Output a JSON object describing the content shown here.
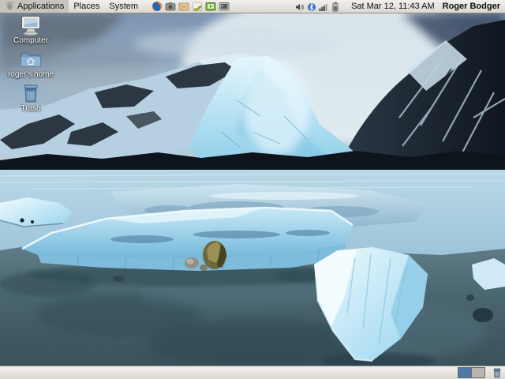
{
  "top_panel": {
    "menus": [
      {
        "label": "Applications"
      },
      {
        "label": "Places"
      },
      {
        "label": "System"
      }
    ],
    "launcher_icons": [
      "firefox-browser",
      "camera",
      "mail",
      "text-editor",
      "media-player",
      "terminal"
    ],
    "status_icons": [
      "volume",
      "bluetooth",
      "network-signal",
      "battery"
    ],
    "clock": "Sat Mar 12, 11:43 AM",
    "user_name": "Roger Bodger"
  },
  "desktop": {
    "icons": [
      {
        "label": "Computer",
        "icon": "computer"
      },
      {
        "label": "roger's home",
        "icon": "home-folder"
      },
      {
        "label": "Trash",
        "icon": "trash"
      }
    ]
  },
  "bottom_panel": {
    "workspace_switcher": {
      "count": 2,
      "active": 1
    },
    "icons": [
      "trash-applet"
    ]
  },
  "colors": {
    "panel_bg": "#e6e2db",
    "panel_border": "#8e8a84",
    "active_workspace": "#4e79a8",
    "inactive_workspace": "#b9b6af",
    "desktop_label_text": "#ffffff"
  }
}
